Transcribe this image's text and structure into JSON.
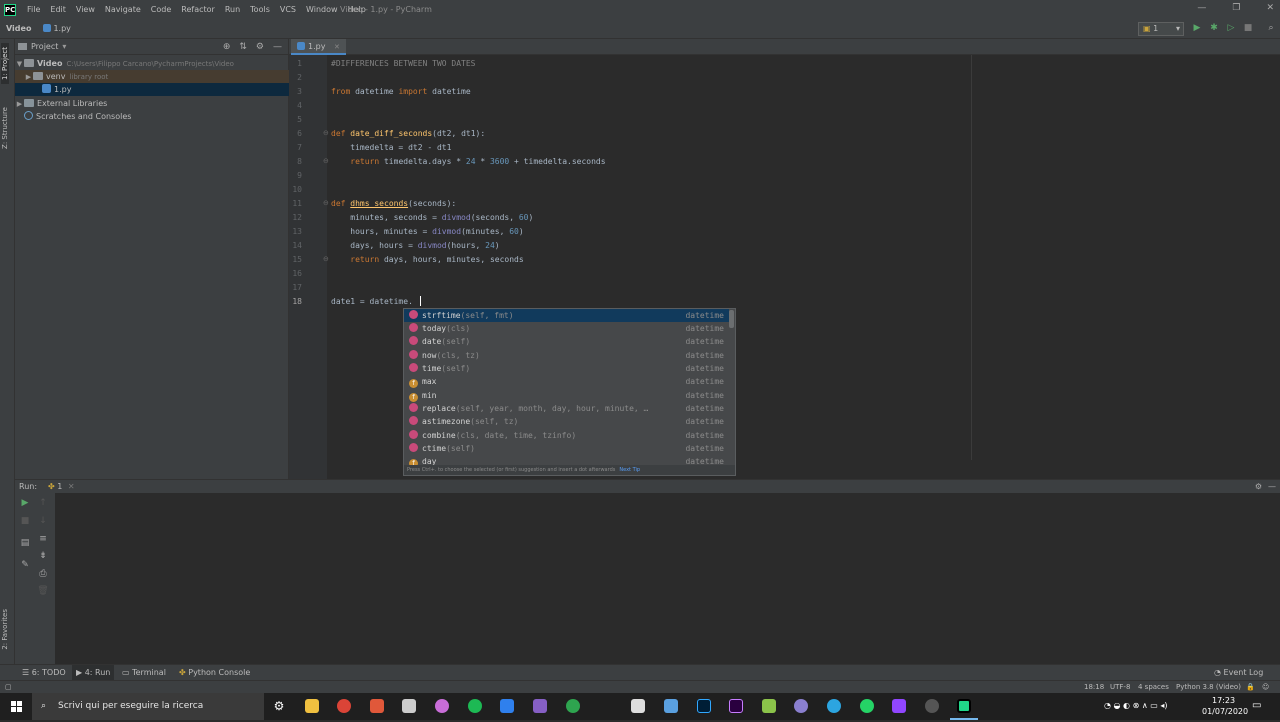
{
  "menubar": {
    "items": [
      "File",
      "Edit",
      "View",
      "Navigate",
      "Code",
      "Refactor",
      "Run",
      "Tools",
      "VCS",
      "Window",
      "Help"
    ],
    "title": "Video - 1.py - PyCharm",
    "logo": "PC"
  },
  "navbar": {
    "crumbs": [
      "Video",
      "1.py"
    ],
    "run_config": "1"
  },
  "left_stripe": {
    "tabs": [
      "1: Project",
      "Z: Structure",
      "2: Favorites"
    ]
  },
  "project": {
    "header": "Project",
    "tree": [
      {
        "label": "Video",
        "extra": "C:\\Users\\Filippo Carcano\\PycharmProjects\\Video"
      },
      {
        "label": "venv",
        "extra": "library root"
      },
      {
        "label": "1.py",
        "extra": ""
      },
      {
        "label": "External Libraries",
        "extra": ""
      },
      {
        "label": "Scratches and Consoles",
        "extra": ""
      }
    ]
  },
  "editor": {
    "tab": "1.py",
    "line_numbers": [
      "1",
      "2",
      "3",
      "4",
      "5",
      "6",
      "7",
      "8",
      "9",
      "10",
      "11",
      "12",
      "13",
      "14",
      "15",
      "16",
      "17",
      "18"
    ],
    "current_line": "18"
  },
  "autocomplete": {
    "items": [
      {
        "name": "strftime",
        "args": "(self, fmt)",
        "type": "datetime",
        "kind": "m"
      },
      {
        "name": "today",
        "args": "(cls)",
        "type": "datetime",
        "kind": "m"
      },
      {
        "name": "date",
        "args": "(self)",
        "type": "datetime",
        "kind": "m"
      },
      {
        "name": "now",
        "args": "(cls, tz)",
        "type": "datetime",
        "kind": "m"
      },
      {
        "name": "time",
        "args": "(self)",
        "type": "datetime",
        "kind": "m"
      },
      {
        "name": "max",
        "args": "",
        "type": "datetime",
        "kind": "f"
      },
      {
        "name": "min",
        "args": "",
        "type": "datetime",
        "kind": "f"
      },
      {
        "name": "replace",
        "args": "(self, year, month, day, hour, minute, …",
        "type": "datetime",
        "kind": "m"
      },
      {
        "name": "astimezone",
        "args": "(self, tz)",
        "type": "datetime",
        "kind": "m"
      },
      {
        "name": "combine",
        "args": "(cls, date, time, tzinfo)",
        "type": "datetime",
        "kind": "m"
      },
      {
        "name": "ctime",
        "args": "(self)",
        "type": "datetime",
        "kind": "m"
      },
      {
        "name": "day",
        "args": "",
        "type": "datetime",
        "kind": "f"
      }
    ],
    "footer": "Press Ctrl+. to choose the selected (or first) suggestion and insert a dot afterwards",
    "footer_link": "Next Tip"
  },
  "run_panel": {
    "label": "Run:",
    "tab": "1"
  },
  "bottom_tabs": [
    "6: TODO",
    "4: Run",
    "Terminal",
    "Python Console"
  ],
  "event_log": "Event Log",
  "status": {
    "position": "18:18",
    "encoding": "UTF-8",
    "indent": "4 spaces",
    "interpreter": "Python 3.8 (Video)"
  },
  "taskbar": {
    "search_placeholder": "Scrivi qui per eseguire la ricerca",
    "time": "17:23",
    "date": "01/07/2020"
  }
}
